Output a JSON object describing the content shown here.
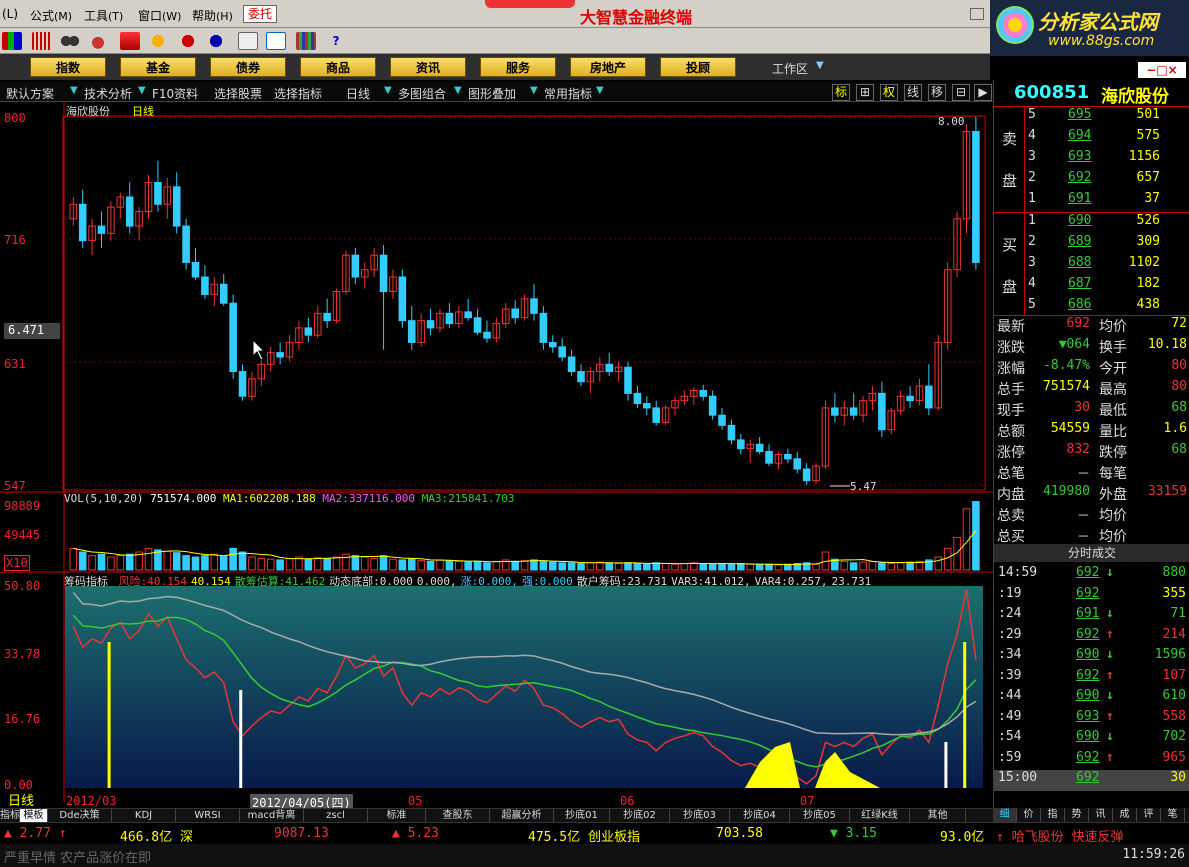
{
  "menu": {
    "items": [
      {
        "label": "(L)",
        "key": ""
      },
      {
        "label": "公式",
        "key": "(M)"
      },
      {
        "label": "工具",
        "key": "(T)"
      },
      {
        "label": "窗口",
        "key": "(W)"
      },
      {
        "label": "帮助",
        "key": "(H)"
      }
    ],
    "weituo": "委托",
    "app_title": "大智慧金融终端"
  },
  "logo": {
    "text": "分析家公式网",
    "url": "www.88gs.com"
  },
  "nav": {
    "buttons": [
      "指数",
      "基金",
      "债券",
      "商品",
      "资讯",
      "服务",
      "房地产",
      "投顾"
    ],
    "workarea": "工作区"
  },
  "chart_toolbar": {
    "items": [
      "默认方案",
      "技术分析",
      "F10资料",
      "选择股票",
      "选择指标",
      "日线",
      "多图组合",
      "图形叠加",
      "常用指标"
    ],
    "right_buttons": [
      "标",
      "⊞",
      "权",
      "线",
      "移",
      "⊟",
      "▶"
    ]
  },
  "chart_data": {
    "type": "candlestick",
    "title": "海欣股份 日线",
    "stock_name": "海欣股份",
    "period": "日线",
    "price_axis": {
      "ticks": [
        "800",
        "716",
        "631",
        "547"
      ],
      "ylim": [
        5.47,
        8.0
      ],
      "current": "6.471"
    },
    "annotations": {
      "high": "8.00",
      "low": "5.47"
    },
    "volume": {
      "header": "VOL(5,10,20)",
      "vol": "751574.000",
      "ma1_label": "MA1:",
      "ma1": "602208.188",
      "ma2_label": "MA2:",
      "ma2": "337116.000",
      "ma3_label": "MA3:",
      "ma3": "215841.703",
      "ticks": [
        "98889",
        "49445",
        "X10"
      ]
    },
    "indicator": {
      "name": "筹码指标",
      "fields": [
        {
          "label": "风险:",
          "value": "40.154",
          "color": "#e33"
        },
        {
          "label": "",
          "value": "40.154",
          "color": "#ff0"
        },
        {
          "label": "散筹估算:",
          "value": "41.462",
          "color": "#3c3"
        },
        {
          "label": "动态底部:",
          "value": "0.000",
          "color": "#ddd"
        },
        {
          "label": "",
          "value": "0.000,",
          "color": "#ddd"
        },
        {
          "label": "涨:",
          "value": "0.000,",
          "color": "#3cf"
        },
        {
          "label": "强:",
          "value": "0.000",
          "color": "#3cf"
        },
        {
          "label": "散户筹码:",
          "value": "23.731",
          "color": "#ddd"
        },
        {
          "label": "VAR3:",
          "value": "41.012,",
          "color": "#ddd"
        },
        {
          "label": "VAR4:",
          "value": "0.257,",
          "color": "#ddd"
        },
        {
          "label": "",
          "value": "23.731",
          "color": "#ddd"
        }
      ],
      "ticks": [
        "50.80",
        "33.78",
        "16.76",
        "0.00"
      ]
    },
    "date_axis": {
      "labels": [
        "2012/03",
        "2012/04/05(四)",
        "05",
        "06",
        "07"
      ]
    },
    "period_label": "日线",
    "candles": [
      [
        7.3,
        7.45,
        7.25,
        7.4
      ],
      [
        7.4,
        7.5,
        7.1,
        7.15
      ],
      [
        7.15,
        7.3,
        7.05,
        7.25
      ],
      [
        7.25,
        7.35,
        7.1,
        7.2
      ],
      [
        7.2,
        7.42,
        7.15,
        7.38
      ],
      [
        7.38,
        7.48,
        7.3,
        7.45
      ],
      [
        7.45,
        7.55,
        7.2,
        7.25
      ],
      [
        7.25,
        7.38,
        7.15,
        7.35
      ],
      [
        7.35,
        7.6,
        7.3,
        7.55
      ],
      [
        7.55,
        7.7,
        7.35,
        7.4
      ],
      [
        7.4,
        7.58,
        7.3,
        7.52
      ],
      [
        7.52,
        7.62,
        7.2,
        7.25
      ],
      [
        7.25,
        7.3,
        6.95,
        7.0
      ],
      [
        7.0,
        7.1,
        6.88,
        6.9
      ],
      [
        6.9,
        6.98,
        6.75,
        6.78
      ],
      [
        6.78,
        6.9,
        6.7,
        6.85
      ],
      [
        6.85,
        6.92,
        6.7,
        6.72
      ],
      [
        6.72,
        6.78,
        6.2,
        6.25
      ],
      [
        6.25,
        6.3,
        6.05,
        6.08
      ],
      [
        6.08,
        6.25,
        6.05,
        6.2
      ],
      [
        6.2,
        6.35,
        6.15,
        6.3
      ],
      [
        6.3,
        6.42,
        6.25,
        6.38
      ],
      [
        6.38,
        6.45,
        6.3,
        6.35
      ],
      [
        6.35,
        6.5,
        6.32,
        6.45
      ],
      [
        6.45,
        6.6,
        6.4,
        6.55
      ],
      [
        6.55,
        6.62,
        6.45,
        6.5
      ],
      [
        6.5,
        6.7,
        6.48,
        6.65
      ],
      [
        6.65,
        6.75,
        6.55,
        6.6
      ],
      [
        6.6,
        6.82,
        6.58,
        6.8
      ],
      [
        6.8,
        7.08,
        6.78,
        7.05
      ],
      [
        7.05,
        7.1,
        6.85,
        6.9
      ],
      [
        6.9,
        7.0,
        6.82,
        6.95
      ],
      [
        6.95,
        7.1,
        6.9,
        7.05
      ],
      [
        7.05,
        7.12,
        6.4,
        6.8
      ],
      [
        6.8,
        6.95,
        6.75,
        6.9
      ],
      [
        6.9,
        6.95,
        6.55,
        6.6
      ],
      [
        6.6,
        6.7,
        6.4,
        6.45
      ],
      [
        6.45,
        6.65,
        6.42,
        6.6
      ],
      [
        6.6,
        6.68,
        6.5,
        6.55
      ],
      [
        6.55,
        6.68,
        6.52,
        6.65
      ],
      [
        6.65,
        6.72,
        6.55,
        6.58
      ],
      [
        6.58,
        6.7,
        6.55,
        6.66
      ],
      [
        6.66,
        6.75,
        6.6,
        6.62
      ],
      [
        6.62,
        6.68,
        6.5,
        6.52
      ],
      [
        6.52,
        6.6,
        6.45,
        6.48
      ],
      [
        6.48,
        6.62,
        6.45,
        6.58
      ],
      [
        6.58,
        6.72,
        6.55,
        6.68
      ],
      [
        6.68,
        6.74,
        6.58,
        6.62
      ],
      [
        6.62,
        6.78,
        6.6,
        6.75
      ],
      [
        6.75,
        6.85,
        6.6,
        6.65
      ],
      [
        6.65,
        6.7,
        6.4,
        6.45
      ],
      [
        6.45,
        6.5,
        6.38,
        6.42
      ],
      [
        6.42,
        6.48,
        6.32,
        6.35
      ],
      [
        6.35,
        6.4,
        6.22,
        6.25
      ],
      [
        6.25,
        6.3,
        6.15,
        6.18
      ],
      [
        6.18,
        6.28,
        6.1,
        6.25
      ],
      [
        6.25,
        6.35,
        6.18,
        6.3
      ],
      [
        6.3,
        6.38,
        6.22,
        6.25
      ],
      [
        6.25,
        6.32,
        6.18,
        6.28
      ],
      [
        6.28,
        6.32,
        6.05,
        6.1
      ],
      [
        6.1,
        6.15,
        6.0,
        6.03
      ],
      [
        6.03,
        6.08,
        5.95,
        6.0
      ],
      [
        6.0,
        6.05,
        5.88,
        5.9
      ],
      [
        5.9,
        6.02,
        5.88,
        6.0
      ],
      [
        6.0,
        6.08,
        5.95,
        6.05
      ],
      [
        6.05,
        6.12,
        6.02,
        6.08
      ],
      [
        6.08,
        6.14,
        6.02,
        6.12
      ],
      [
        6.12,
        6.16,
        6.05,
        6.08
      ],
      [
        6.08,
        6.12,
        5.92,
        5.95
      ],
      [
        5.95,
        6.0,
        5.85,
        5.88
      ],
      [
        5.88,
        5.92,
        5.75,
        5.78
      ],
      [
        5.78,
        5.82,
        5.68,
        5.72
      ],
      [
        5.72,
        5.78,
        5.62,
        5.75
      ],
      [
        5.75,
        5.8,
        5.68,
        5.7
      ],
      [
        5.7,
        5.75,
        5.6,
        5.62
      ],
      [
        5.62,
        5.7,
        5.58,
        5.68
      ],
      [
        5.68,
        5.72,
        5.62,
        5.65
      ],
      [
        5.65,
        5.7,
        5.55,
        5.58
      ],
      [
        5.58,
        5.62,
        5.47,
        5.5
      ],
      [
        5.5,
        5.62,
        5.48,
        5.6
      ],
      [
        5.6,
        6.05,
        5.58,
        6.0
      ],
      [
        6.0,
        6.1,
        5.9,
        5.95
      ],
      [
        5.95,
        6.05,
        5.88,
        6.0
      ],
      [
        6.0,
        6.1,
        5.92,
        5.95
      ],
      [
        5.95,
        6.08,
        5.9,
        6.05
      ],
      [
        6.05,
        6.15,
        5.98,
        6.1
      ],
      [
        6.1,
        6.18,
        5.8,
        5.85
      ],
      [
        5.85,
        6.0,
        5.82,
        5.98
      ],
      [
        5.98,
        6.12,
        5.95,
        6.08
      ],
      [
        6.08,
        6.15,
        6.0,
        6.05
      ],
      [
        6.05,
        6.2,
        6.02,
        6.15
      ],
      [
        6.15,
        6.3,
        5.95,
        6.0
      ],
      [
        6.0,
        6.5,
        5.98,
        6.45
      ],
      [
        6.45,
        7.0,
        6.4,
        6.95
      ],
      [
        6.95,
        7.35,
        6.9,
        7.3
      ],
      [
        7.3,
        7.95,
        7.2,
        7.9
      ],
      [
        7.9,
        8.0,
        6.95,
        7.0
      ]
    ],
    "volumes": [
      0.3,
      0.25,
      0.2,
      0.22,
      0.18,
      0.2,
      0.22,
      0.25,
      0.3,
      0.28,
      0.26,
      0.24,
      0.2,
      0.18,
      0.2,
      0.22,
      0.19,
      0.3,
      0.25,
      0.18,
      0.16,
      0.15,
      0.14,
      0.16,
      0.18,
      0.15,
      0.17,
      0.16,
      0.18,
      0.22,
      0.2,
      0.18,
      0.16,
      0.2,
      0.15,
      0.14,
      0.16,
      0.13,
      0.12,
      0.14,
      0.13,
      0.12,
      0.11,
      0.12,
      0.1,
      0.12,
      0.14,
      0.12,
      0.13,
      0.14,
      0.12,
      0.11,
      0.1,
      0.1,
      0.09,
      0.1,
      0.11,
      0.1,
      0.09,
      0.1,
      0.09,
      0.08,
      0.1,
      0.09,
      0.08,
      0.09,
      0.1,
      0.09,
      0.08,
      0.09,
      0.08,
      0.09,
      0.08,
      0.07,
      0.08,
      0.07,
      0.08,
      0.09,
      0.1,
      0.08,
      0.25,
      0.15,
      0.12,
      0.1,
      0.11,
      0.12,
      0.1,
      0.09,
      0.1,
      0.11,
      0.12,
      0.14,
      0.18,
      0.3,
      0.45,
      0.85,
      0.95
    ]
  },
  "quote": {
    "code": "600851",
    "name": "海欣股份",
    "sell_label": [
      "卖",
      "盘"
    ],
    "buy_label": [
      "买",
      "盘"
    ],
    "asks": [
      {
        "lv": "5",
        "px": "695",
        "vol": "501"
      },
      {
        "lv": "4",
        "px": "694",
        "vol": "575"
      },
      {
        "lv": "3",
        "px": "693",
        "vol": "1156"
      },
      {
        "lv": "2",
        "px": "692",
        "vol": "657"
      },
      {
        "lv": "1",
        "px": "691",
        "vol": "37"
      }
    ],
    "bids": [
      {
        "lv": "1",
        "px": "690",
        "vol": "526"
      },
      {
        "lv": "2",
        "px": "689",
        "vol": "309"
      },
      {
        "lv": "3",
        "px": "688",
        "vol": "1102"
      },
      {
        "lv": "4",
        "px": "687",
        "vol": "182"
      },
      {
        "lv": "5",
        "px": "686",
        "vol": "438"
      }
    ],
    "stats": [
      {
        "l": "最新",
        "v": "692",
        "l2": "均价",
        "v2": "72"
      },
      {
        "l": "涨跌",
        "v": "▼064",
        "l2": "换手",
        "v2": "10.18"
      },
      {
        "l": "涨幅",
        "v": "-8.47%",
        "l2": "今开",
        "v2": "80"
      },
      {
        "l": "总手",
        "v": "751574",
        "l2": "最高",
        "v2": "80"
      },
      {
        "l": "现手",
        "v": "30",
        "l2": "最低",
        "v2": "68"
      },
      {
        "l": "总额",
        "v": "54559",
        "l2": "量比",
        "v2": "1.6"
      },
      {
        "l": "涨停",
        "v": "832",
        "l2": "跌停",
        "v2": "68"
      },
      {
        "l": "总笔",
        "v": "－",
        "l2": "每笔",
        "v2": ""
      },
      {
        "l": "内盘",
        "v": "419980",
        "l2": "外盘",
        "v2": "33159"
      },
      {
        "l": "总卖",
        "v": "－",
        "l2": "均价",
        "v2": ""
      },
      {
        "l": "总买",
        "v": "－",
        "l2": "均价",
        "v2": ""
      }
    ],
    "trades_title": "分时成交",
    "trades": [
      {
        "t": "14:59",
        "p": "692",
        "d": "↓",
        "v": "880"
      },
      {
        "t": ":19",
        "p": "692",
        "d": "",
        "v": "355"
      },
      {
        "t": ":24",
        "p": "691",
        "d": "↓",
        "v": "71"
      },
      {
        "t": ":29",
        "p": "692",
        "d": "↑",
        "v": "214"
      },
      {
        "t": ":34",
        "p": "690",
        "d": "↓",
        "v": "1596"
      },
      {
        "t": ":39",
        "p": "692",
        "d": "↑",
        "v": "107"
      },
      {
        "t": ":44",
        "p": "690",
        "d": "↓",
        "v": "610"
      },
      {
        "t": ":49",
        "p": "693",
        "d": "↑",
        "v": "558"
      },
      {
        "t": ":54",
        "p": "690",
        "d": "↓",
        "v": "702"
      },
      {
        "t": ":59",
        "p": "692",
        "d": "↑",
        "v": "965"
      },
      {
        "t": "15:00",
        "p": "692",
        "d": "",
        "v": "30"
      }
    ],
    "right_tabs": [
      "细",
      "价",
      "指",
      "势",
      "讯",
      "成",
      "评",
      "笔"
    ]
  },
  "bottom_tabs": [
    "指标",
    "模板",
    "Dde决策",
    "KDJ",
    "WRSI",
    "macd背离",
    "zscl",
    "标准",
    "查股东",
    "超赢分析",
    "抄底01",
    "抄底02",
    "抄底03",
    "抄底04",
    "抄底05",
    "红绿K线",
    "其他"
  ],
  "status": [
    {
      "text": "▲ 2.77 ↑",
      "color": "#e33"
    },
    {
      "text": "466.8亿 深",
      "color": "#ff0"
    },
    {
      "text": "9087.13",
      "color": "#e33"
    },
    {
      "text": "▲ 5.23",
      "color": "#e33"
    },
    {
      "text": "475.5亿 创业板指",
      "color": "#ff0"
    },
    {
      "text": "703.58",
      "color": "#ff0"
    },
    {
      "text": "▼ 3.15",
      "color": "#3c3"
    },
    {
      "text": "93.0亿",
      "color": "#ff0"
    },
    {
      "text": "↑ 哈飞股份 快速反弹",
      "color": "#e33"
    }
  ],
  "ticker": "严重早情 农产品涨价在即",
  "clock": "11:59:26"
}
